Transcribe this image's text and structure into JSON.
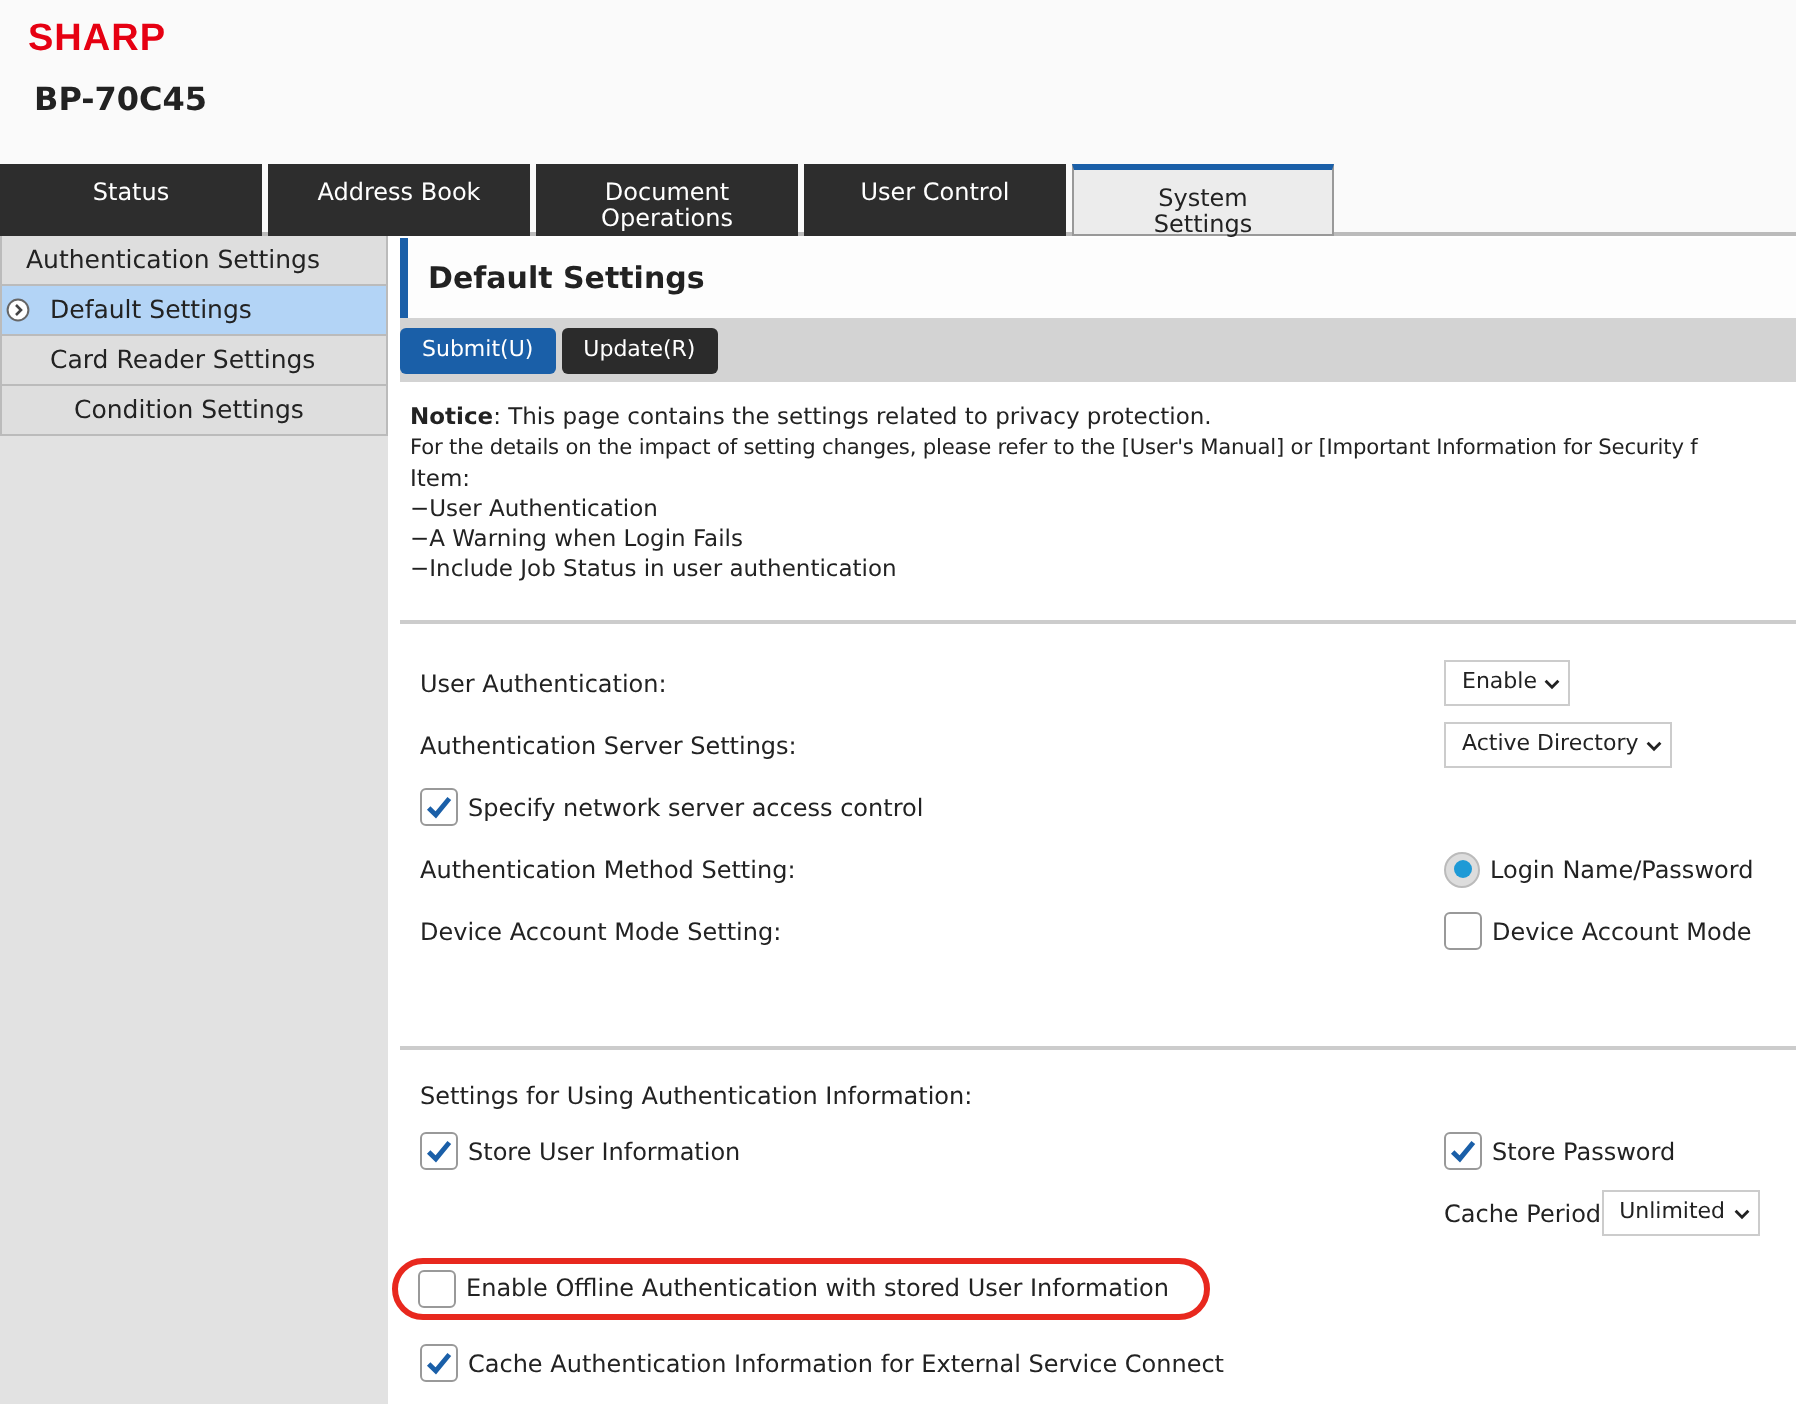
{
  "header": {
    "logo": "SHARP",
    "model": "BP-70C45"
  },
  "tabs": [
    {
      "label": "Status",
      "selected": false
    },
    {
      "label": "Address Book",
      "selected": false
    },
    {
      "label": "Document\nOperations",
      "selected": false
    },
    {
      "label": "User Control",
      "selected": false
    },
    {
      "label": "System\nSettings",
      "selected": true
    }
  ],
  "sidebar": {
    "items": [
      {
        "label": "Authentication Settings",
        "selected": false,
        "children": [
          {
            "label": "Default Settings",
            "selected": true
          },
          {
            "label": "Card Reader Settings",
            "selected": false,
            "children": [
              {
                "label": "Condition Settings",
                "selected": false
              }
            ]
          }
        ]
      }
    ]
  },
  "page": {
    "title": "Default Settings",
    "buttons": [
      {
        "label": "Submit(U)",
        "kind": "primary"
      },
      {
        "label": "Update(R)",
        "kind": "dark"
      }
    ],
    "notice": {
      "lead": "**Notice**: This page contains the settings related to privacy protection.",
      "detail": "For the details on the impact of setting changes, please refer to the [User's Manual] or [Important Information for Security f",
      "item_heading": "Item:",
      "items": [
        "−User Authentication",
        "−A Warning when Login Fails",
        "−Include Job Status in user authentication"
      ]
    },
    "sections": [
      {
        "rows": [
          {
            "label": "User Authentication:",
            "right": {
              "kind": "select",
              "value": "Enable"
            }
          },
          {
            "label": "Authentication Server Settings:",
            "right": {
              "kind": "select",
              "value": "Active Directory"
            }
          },
          {
            "left": {
              "kind": "checkbox",
              "label": "Specify network server access control",
              "checked": true
            }
          },
          {
            "label": "Authentication Method Setting:",
            "right": {
              "kind": "radio",
              "label": "Login Name/Password",
              "selected": true
            }
          },
          {
            "label": "Device Account Mode Setting:",
            "right": {
              "kind": "checkbox",
              "label": "Device Account Mode",
              "checked": false
            }
          }
        ]
      },
      {
        "title": "Settings for Using Authentication Information:",
        "rows": [
          {
            "left": {
              "kind": "checkbox",
              "label": "Store User Information",
              "checked": true
            },
            "right": {
              "kind": "checkbox",
              "label": "Store Password",
              "checked": true
            }
          },
          {
            "right": {
              "kind": "select",
              "label": "Cache Period",
              "value": "Unlimited"
            }
          },
          {
            "left": {
              "kind": "checkbox",
              "label": "Enable Offline Authentication with stored User Information",
              "checked": false
            },
            "highlighted": true
          },
          {
            "left": {
              "kind": "checkbox",
              "label": "Cache Authentication Information for External Service Connect",
              "checked": true
            }
          }
        ]
      }
    ]
  }
}
